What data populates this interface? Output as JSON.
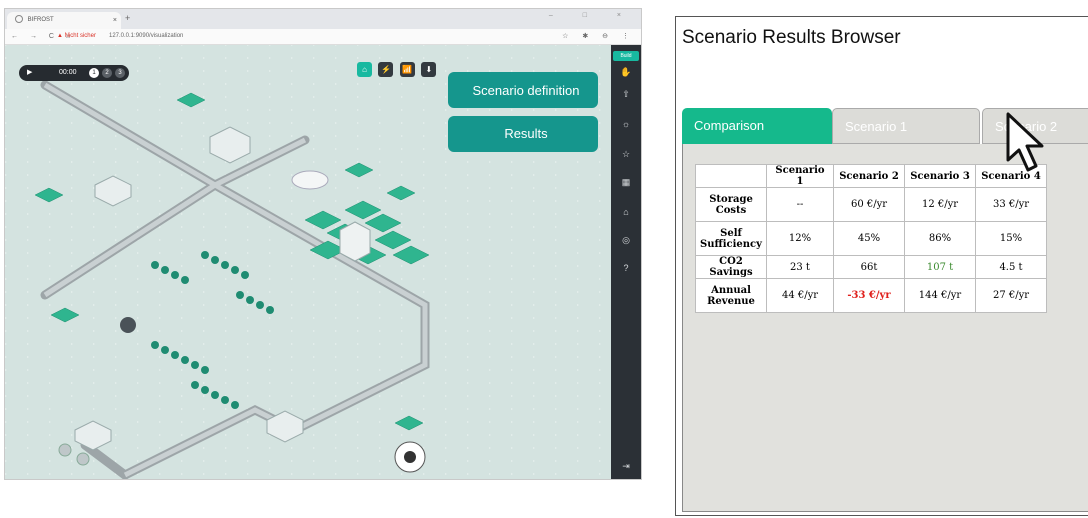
{
  "browser": {
    "tab_title": "BIFROST",
    "tab_close": "×",
    "new_tab": "+",
    "window_controls": "–  □  ×",
    "nav_buttons": "← → C ⌂",
    "security_warning": "▲ Nicht sicher",
    "url": "127.0.0.1:9090/visualization",
    "addr_right_icons": "☆ ✱ ⊖ ⋮"
  },
  "sim": {
    "time": "00:00",
    "play_icon": "play-icon",
    "speed_buttons": [
      "1",
      "2",
      "3"
    ],
    "tool_icons": [
      "⌂",
      "⚡",
      "📶",
      "⬇"
    ],
    "sidebar_build": "Build",
    "sidebar_icons": [
      "✋",
      "⇧",
      "☼",
      "☆",
      "▦",
      "⌂",
      "◎",
      "?",
      "⇥"
    ]
  },
  "panel": {
    "scenario_definition": "Scenario definition",
    "results": "Results"
  },
  "results_browser": {
    "title": "Scenario Results Browser",
    "tabs": [
      "Comparison",
      "Scenario 1",
      "Scenario 2"
    ],
    "table": {
      "headers": [
        "",
        "Scenario 1",
        "Scenario 2",
        "Scenario 3",
        "Scenario 4"
      ],
      "rows": [
        {
          "label": "Storage Costs",
          "cells": [
            "--",
            "60 €/yr",
            "12 €/yr",
            "33 €/yr"
          ]
        },
        {
          "label": "Self Sufficiency",
          "cells": [
            "12%",
            "45%",
            "86%",
            "15%"
          ]
        },
        {
          "label": "CO2 Savings",
          "cells": [
            "23 t",
            "66t",
            "107 t",
            "4.5 t"
          ]
        },
        {
          "label": "Annual Revenue",
          "cells": [
            "44 €/yr",
            "-33 €/yr",
            "144 €/yr",
            "27 €/yr"
          ]
        }
      ]
    }
  },
  "colors": {
    "accent": "#15968d",
    "tab_active": "#15b98c",
    "positive": "#3a8a2e",
    "negative": "#e0201c"
  }
}
